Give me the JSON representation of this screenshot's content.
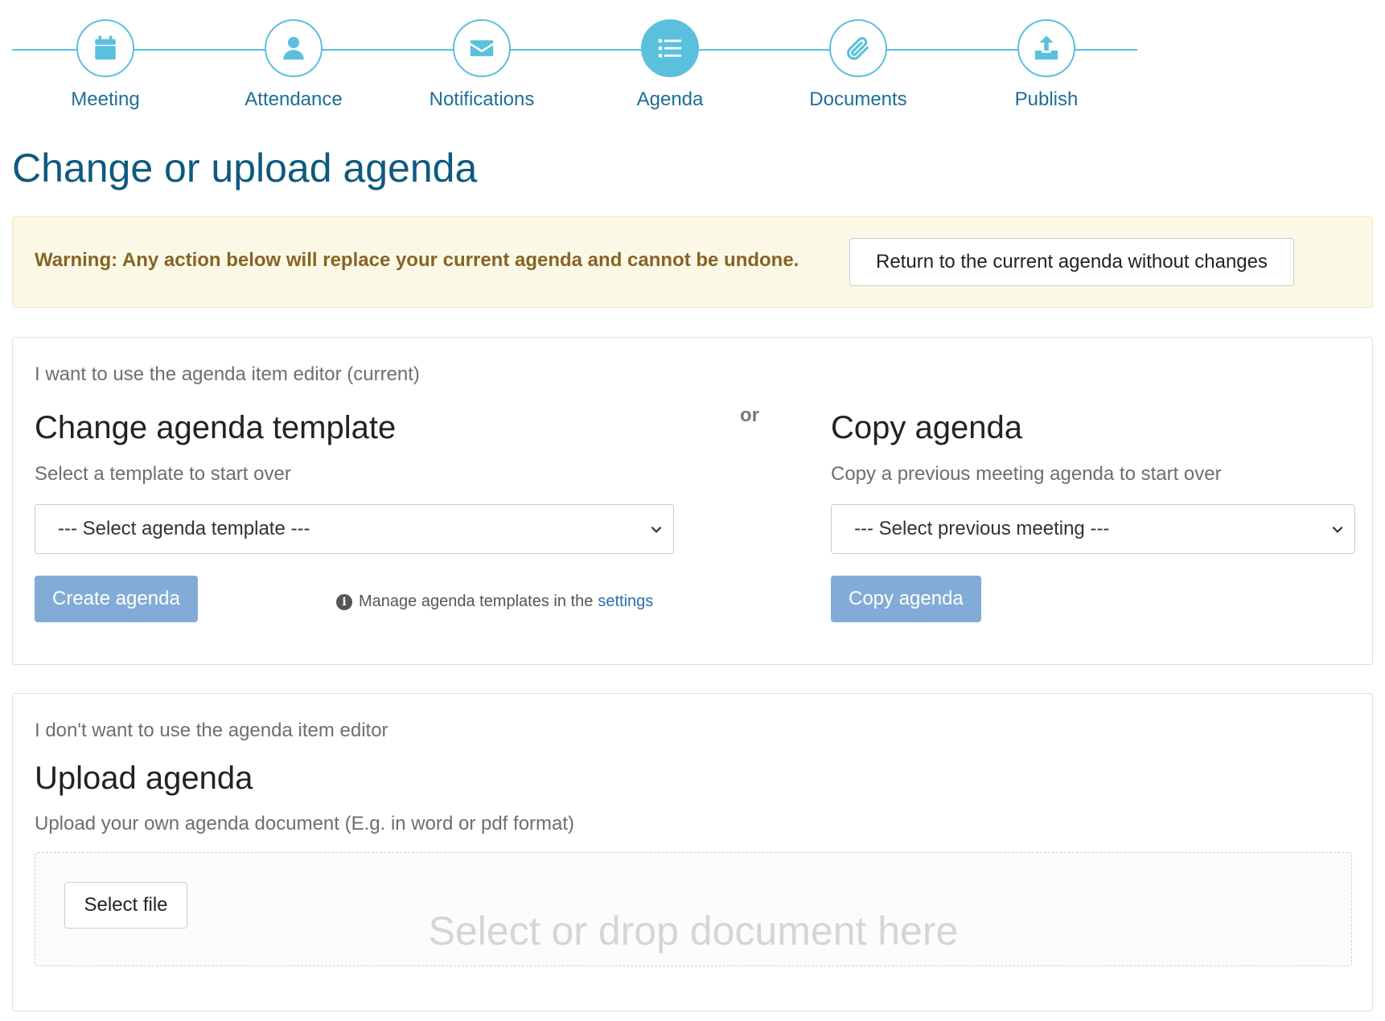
{
  "stepper": {
    "steps": [
      {
        "label": "Meeting",
        "icon": "calendar-icon",
        "active": false
      },
      {
        "label": "Attendance",
        "icon": "user-icon",
        "active": false
      },
      {
        "label": "Notifications",
        "icon": "envelope-icon",
        "active": false
      },
      {
        "label": "Agenda",
        "icon": "list-icon",
        "active": true
      },
      {
        "label": "Documents",
        "icon": "paperclip-icon",
        "active": false
      },
      {
        "label": "Publish",
        "icon": "upload-icon",
        "active": false
      }
    ],
    "accent_color": "#5bc0de"
  },
  "page": {
    "title": "Change or upload agenda"
  },
  "warning": {
    "text": "Warning: Any action below will replace your current agenda and cannot be undone.",
    "return_button": "Return to the current agenda without changes"
  },
  "editor_panel": {
    "heading": "I want to use the agenda item editor (current)",
    "or_text": "or",
    "template": {
      "title": "Change agenda template",
      "subtitle": "Select a template to start over",
      "select_value": "--- Select agenda template ---",
      "button": "Create agenda",
      "hint_text": "Manage agenda templates in the",
      "hint_link": "settings"
    },
    "copy": {
      "title": "Copy agenda",
      "subtitle": "Copy a previous meeting agenda to start over",
      "select_value": "--- Select previous meeting ---",
      "button": "Copy agenda"
    }
  },
  "upload_panel": {
    "heading": "I don't want to use the agenda item editor",
    "title": "Upload agenda",
    "subtitle": "Upload your own agenda document (E.g. in word or pdf format)",
    "select_file_button": "Select file",
    "drop_text": "Select or drop document here"
  }
}
